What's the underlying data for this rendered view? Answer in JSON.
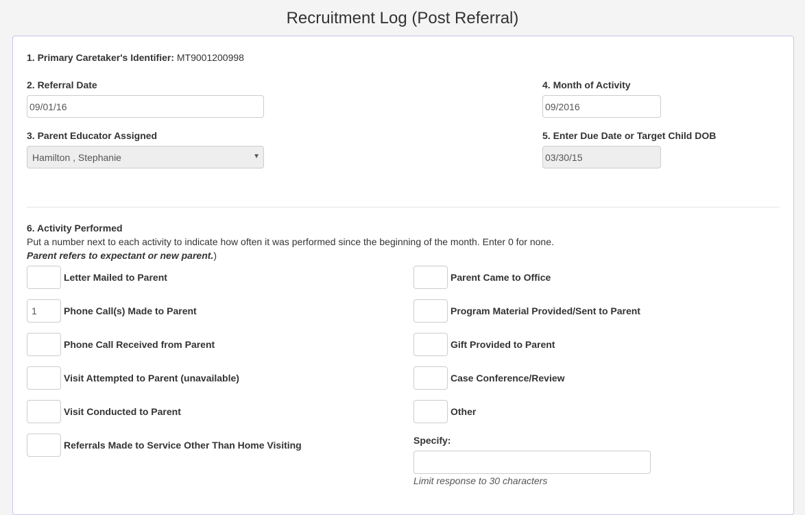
{
  "page": {
    "title": "Recruitment Log (Post Referral)"
  },
  "caretaker": {
    "label": "1. Primary Caretaker's Identifier:",
    "value": "MT9001200998"
  },
  "referral_date": {
    "label": "2. Referral Date",
    "value": "09/01/16"
  },
  "parent_educator": {
    "label": "3. Parent Educator Assigned",
    "selected": "Hamilton , Stephanie"
  },
  "month_activity": {
    "label": "4. Month of Activity",
    "value": "09/2016"
  },
  "due_date": {
    "label": "5. Enter Due Date or Target Child DOB",
    "value": "03/30/15"
  },
  "activity": {
    "heading": "6. Activity Performed",
    "instructions": "Put a number next to each activity to indicate how often it was performed since the beginning of the month. Enter 0 for none.",
    "note_emphasis": "Parent refers to expectant or new parent.",
    "note_suffix": ")",
    "left": [
      {
        "label": "Letter Mailed to Parent",
        "value": ""
      },
      {
        "label": "Phone Call(s) Made to Parent",
        "value": "1"
      },
      {
        "label": "Phone Call Received from Parent",
        "value": ""
      },
      {
        "label": "Visit Attempted to Parent (unavailable)",
        "value": ""
      },
      {
        "label": "Visit Conducted to Parent",
        "value": ""
      },
      {
        "label": "Referrals Made to Service Other Than Home Visiting",
        "value": ""
      }
    ],
    "right": [
      {
        "label": "Parent Came to Office",
        "value": ""
      },
      {
        "label": "Program Material Provided/Sent to Parent",
        "value": ""
      },
      {
        "label": "Gift Provided to Parent",
        "value": ""
      },
      {
        "label": "Case Conference/Review",
        "value": ""
      },
      {
        "label": "Other",
        "value": ""
      }
    ],
    "specify": {
      "label": "Specify:",
      "value": "",
      "hint": "Limit response to 30 characters"
    }
  }
}
